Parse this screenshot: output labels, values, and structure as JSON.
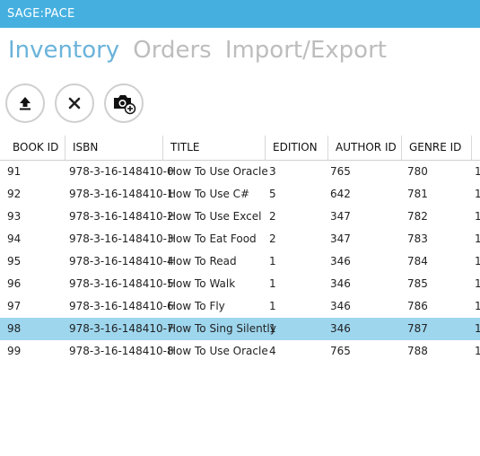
{
  "window": {
    "title": "SAGE:PACE"
  },
  "tabs": [
    {
      "label": "Inventory",
      "active": true
    },
    {
      "label": "Orders",
      "active": false
    },
    {
      "label": "Import/Export",
      "active": false
    }
  ],
  "toolbar": {
    "buttons": [
      {
        "name": "upload-button",
        "icon": "upload-icon"
      },
      {
        "name": "delete-button",
        "icon": "close-icon"
      },
      {
        "name": "add-photo-button",
        "icon": "camera-add-icon"
      }
    ]
  },
  "colors": {
    "accent": "#45b0e0",
    "active_tab": "#6ab3da",
    "inactive_tab": "#bdbdbd",
    "selected_row": "#9ed6ee"
  },
  "table": {
    "columns": [
      "BOOK ID",
      "ISBN",
      "TITLE",
      "EDITION",
      "AUTHOR ID",
      "GENRE ID"
    ],
    "selected_index": 7,
    "rows": [
      [
        "91",
        "978-3-16-148410-0",
        "How To Use Oracle",
        "3",
        "765",
        "780",
        "1"
      ],
      [
        "92",
        "978-3-16-148410-1",
        "How To Use C#",
        "5",
        "642",
        "781",
        "1"
      ],
      [
        "93",
        "978-3-16-148410-2",
        "How To Use Excel",
        "2",
        "347",
        "782",
        "1"
      ],
      [
        "94",
        "978-3-16-148410-3",
        "How To Eat Food",
        "2",
        "347",
        "783",
        "1"
      ],
      [
        "95",
        "978-3-16-148410-4",
        "How To Read",
        "1",
        "346",
        "784",
        "1"
      ],
      [
        "96",
        "978-3-16-148410-5",
        "How To Walk",
        "1",
        "346",
        "785",
        "1"
      ],
      [
        "97",
        "978-3-16-148410-6",
        "How To Fly",
        "1",
        "346",
        "786",
        "1"
      ],
      [
        "98",
        "978-3-16-148410-7",
        "How To Sing Silently",
        "1",
        "346",
        "787",
        "1"
      ],
      [
        "99",
        "978-3-16-148410-8",
        "How To Use Oracle",
        "4",
        "765",
        "788",
        "1"
      ]
    ]
  }
}
